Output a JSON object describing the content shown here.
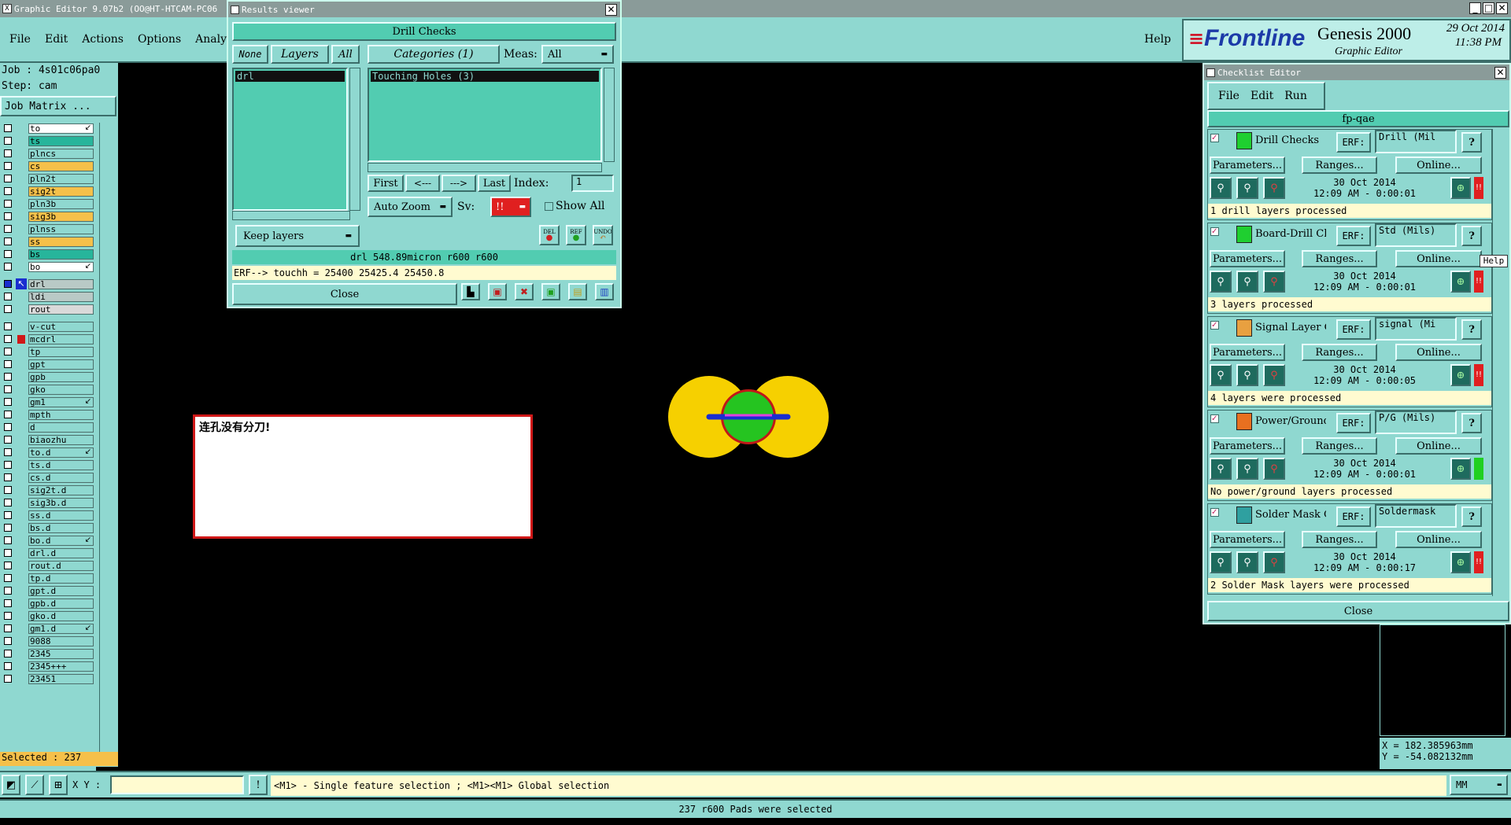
{
  "main": {
    "title": "Graphic Editor 9.07b2 (OO@HT-HTCAM-PC06",
    "menu": [
      "File",
      "Edit",
      "Actions",
      "Options",
      "Analysis"
    ],
    "help": "Help",
    "brand": "Frontline",
    "product": "Genesis 2000",
    "product_sub": "Graphic Editor",
    "date": "29 Oct 2014",
    "time": "11:38 PM",
    "job": "Job : 4s01c06pa0",
    "step": "Step: cam",
    "job_matrix": "Job Matrix ...",
    "selected": "Selected : 237",
    "xy_label": "X Y :",
    "hint": "<M1> - Single feature selection ; <M1><M1> Global selection",
    "status": "237 r600 Pads were selected",
    "units": "MM",
    "coord_x": "X = 182.385963mm",
    "coord_y": "Y = -54.082132mm"
  },
  "layers": [
    {
      "name": "to",
      "color": "#ffffff",
      "tick": true
    },
    {
      "name": "ts",
      "color": "#27b59b"
    },
    {
      "name": "plncs",
      "color": "#8fd8d0"
    },
    {
      "name": "cs",
      "color": "#f5c04a"
    },
    {
      "name": "pln2t",
      "color": "#8fd8d0"
    },
    {
      "name": "sig2t",
      "color": "#f5c04a"
    },
    {
      "name": "pln3b",
      "color": "#8fd8d0"
    },
    {
      "name": "sig3b",
      "color": "#f5c04a"
    },
    {
      "name": "plnss",
      "color": "#8fd8d0"
    },
    {
      "name": "ss",
      "color": "#f5c04a"
    },
    {
      "name": "bs",
      "color": "#27b59b"
    },
    {
      "name": "bo",
      "color": "#ffffff",
      "tick": true
    },
    {
      "name": "drl",
      "color": "#b9c9c6",
      "active": true
    },
    {
      "name": "ldi",
      "color": "#b9c9c6"
    },
    {
      "name": "rout",
      "color": "#d9d9d9"
    },
    {
      "name": "v-cut",
      "color": "#8fd8d0"
    },
    {
      "name": "mcdrl",
      "color": "#8fd8d0",
      "red": true
    },
    {
      "name": "tp",
      "color": "#8fd8d0"
    },
    {
      "name": "gpt",
      "color": "#8fd8d0"
    },
    {
      "name": "gpb",
      "color": "#8fd8d0"
    },
    {
      "name": "gko",
      "color": "#8fd8d0"
    },
    {
      "name": "gm1",
      "color": "#8fd8d0",
      "tick": true
    },
    {
      "name": "mpth",
      "color": "#8fd8d0"
    },
    {
      "name": "d",
      "color": "#8fd8d0"
    },
    {
      "name": "biaozhu",
      "color": "#8fd8d0"
    },
    {
      "name": "to.d",
      "color": "#8fd8d0",
      "tick": true
    },
    {
      "name": "ts.d",
      "color": "#8fd8d0"
    },
    {
      "name": "cs.d",
      "color": "#8fd8d0"
    },
    {
      "name": "sig2t.d",
      "color": "#8fd8d0"
    },
    {
      "name": "sig3b.d",
      "color": "#8fd8d0"
    },
    {
      "name": "ss.d",
      "color": "#8fd8d0"
    },
    {
      "name": "bs.d",
      "color": "#8fd8d0"
    },
    {
      "name": "bo.d",
      "color": "#8fd8d0",
      "tick": true
    },
    {
      "name": "drl.d",
      "color": "#8fd8d0"
    },
    {
      "name": "rout.d",
      "color": "#8fd8d0"
    },
    {
      "name": "tp.d",
      "color": "#8fd8d0"
    },
    {
      "name": "gpt.d",
      "color": "#8fd8d0"
    },
    {
      "name": "gpb.d",
      "color": "#8fd8d0"
    },
    {
      "name": "gko.d",
      "color": "#8fd8d0"
    },
    {
      "name": "gm1.d",
      "color": "#8fd8d0",
      "tick": true
    },
    {
      "name": "9088",
      "color": "#8fd8d0"
    },
    {
      "name": "2345",
      "color": "#8fd8d0"
    },
    {
      "name": "2345+++",
      "color": "#8fd8d0"
    },
    {
      "name": "23451",
      "color": "#8fd8d0"
    }
  ],
  "note": "连孔没有分刀!",
  "results": {
    "title": "Results viewer",
    "header": "Drill Checks",
    "none": "None",
    "layers": "Layers",
    "all": "All",
    "categories": "Categories (1)",
    "meas": "Meas:",
    "meas_value": "All",
    "layer_item": "drl",
    "category_item": "Touching Holes (3)",
    "first": "First",
    "prev": "<---",
    "next": "--->",
    "last": "Last",
    "index_label": "Index:",
    "index_value": "1",
    "auto_zoom": "Auto Zoom",
    "sv": "Sv:",
    "sv_value": "!!",
    "show_all": "Show All",
    "keep_layers": "Keep layers",
    "del": "DEL",
    "ref": "REF",
    "undo": "UNDO",
    "info": "drl 548.89micron  r600  r600",
    "erf": "ERF--> touchh = 25400 25425.4 25450.8",
    "close": "Close"
  },
  "checklist": {
    "title": "Checklist Editor",
    "menu": [
      "File",
      "Edit",
      "Run"
    ],
    "name": "fp-qae",
    "erf_label": "ERF:",
    "params": "Parameters...",
    "ranges": "Ranges...",
    "online": "Online...",
    "help_tip": "Help",
    "close": "Close",
    "items": [
      {
        "name": "Drill Checks",
        "erf": "Drill (Mil",
        "date": "30 Oct 2014",
        "time": "12:09 AM - 0:00:01",
        "msg": "1 drill layers processed",
        "status": "#e02020",
        "icon_color": "#1fcf30"
      },
      {
        "name": "Board-Drill Che",
        "erf": "Std (Mils)",
        "date": "30 Oct 2014",
        "time": "12:09 AM - 0:00:01",
        "msg": "3 layers processed",
        "status": "#e02020",
        "icon_color": "#1fcf30"
      },
      {
        "name": "Signal Layer Ch",
        "erf": "signal (Mi",
        "date": "30 Oct 2014",
        "time": "12:09 AM - 0:00:05",
        "msg": "4 layers were processed",
        "status": "#e02020",
        "icon_color": "#e8a040"
      },
      {
        "name": "Power/Ground C",
        "erf": "P/G (Mils)",
        "date": "30 Oct 2014",
        "time": "12:09 AM - 0:00:01",
        "msg": "No power/ground layers processed",
        "status": "#20d020",
        "icon_color": "#e87020"
      },
      {
        "name": "Solder Mask Ch",
        "erf": "Soldermask",
        "date": "30 Oct 2014",
        "time": "12:09 AM - 0:00:17",
        "msg": "2 Solder Mask layers were processed",
        "status": "#e02020",
        "icon_color": "#2fa0a0"
      }
    ]
  }
}
